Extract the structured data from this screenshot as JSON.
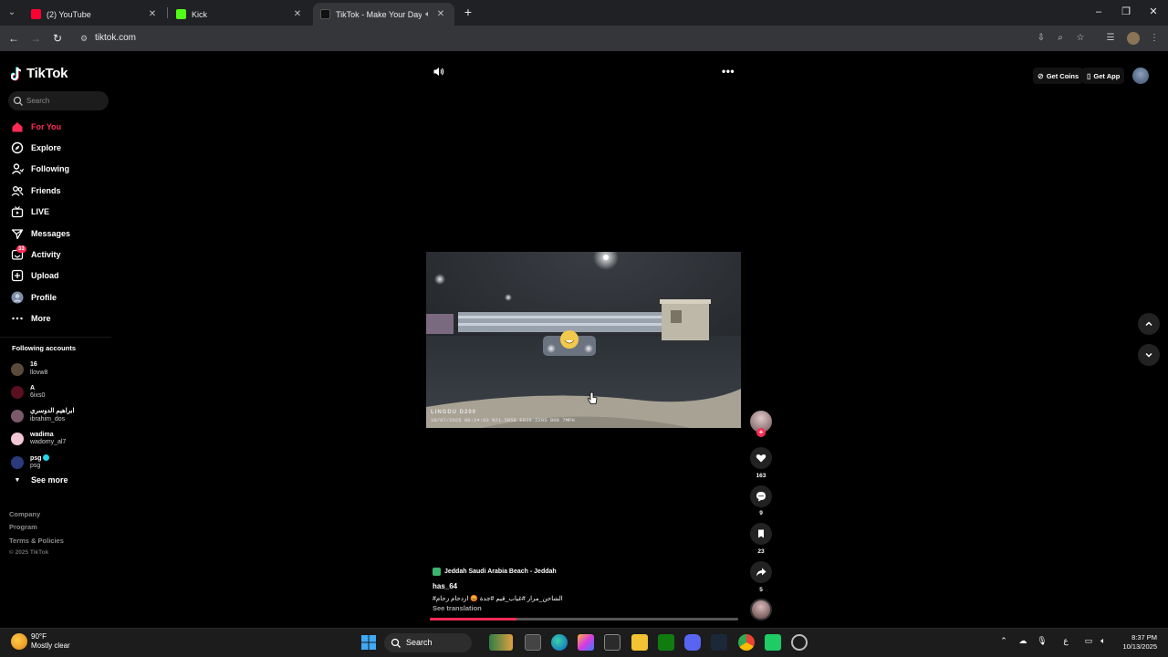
{
  "browser": {
    "tabs": [
      {
        "title": "(2) YouTube",
        "favicon_color": "#ff0033"
      },
      {
        "title": "Kick",
        "favicon_color": "#53fc18"
      },
      {
        "title": "TikTok - Make Your Day",
        "favicon_color": "#111111",
        "audio_icon": "speaker-icon"
      }
    ],
    "active_tab_index": 2,
    "url": "tiktok.com"
  },
  "tiktok": {
    "logo_text": "TikTok",
    "search_placeholder": "Search",
    "nav": [
      {
        "label": "For You",
        "icon": "home-icon",
        "active": true
      },
      {
        "label": "Explore",
        "icon": "compass-icon"
      },
      {
        "label": "Following",
        "icon": "following-icon"
      },
      {
        "label": "Friends",
        "icon": "friends-icon"
      },
      {
        "label": "LIVE",
        "icon": "live-icon"
      },
      {
        "label": "Messages",
        "icon": "messages-icon"
      },
      {
        "label": "Activity",
        "icon": "activity-icon",
        "badge": "33"
      },
      {
        "label": "Upload",
        "icon": "upload-icon"
      },
      {
        "label": "Profile",
        "icon": "profile-avatar"
      },
      {
        "label": "More",
        "icon": "more-icon"
      }
    ],
    "following_title": "Following accounts",
    "following": [
      {
        "name": "16",
        "handle": "llovw8",
        "color": "#5a4a3a"
      },
      {
        "name": "A",
        "handle": "6ixs0",
        "color": "#5a1020"
      },
      {
        "name": "ابراهيم الدوسري",
        "handle": "ibrahim_dos",
        "color": "#7a5a6a"
      },
      {
        "name": "wadima",
        "handle": "wadomy_al7",
        "color": "#f2c6d6"
      },
      {
        "name": "psg",
        "handle": "psg",
        "color": "#2a3a7a",
        "verified": true
      }
    ],
    "see_more": "See more",
    "footer": [
      "Company",
      "Program",
      "Terms & Policies"
    ],
    "copyright": "© 2025 TikTok",
    "get_coins": "Get Coins",
    "get_app": "Get App",
    "video": {
      "hud_brand": "LINGDU D200",
      "hud_line": "10/07/2025  00:24:03  N21.5058  E039.2205  008  7MPH",
      "location": "Jeddah Saudi Arabia Beach - Jeddah",
      "author": "has_64",
      "description": "#الشاحن_مرار  #غياب_قيم  #جدة 😡 ازدحام زحام",
      "see_translation": "See translation",
      "progress": 0.28
    },
    "actions": {
      "likes": "163",
      "comments": "9",
      "saves": "23",
      "shares": "5"
    }
  },
  "taskbar": {
    "weather_temp": "90°F",
    "weather_desc": "Mostly clear",
    "search_label": "Search",
    "lang": "ع",
    "time": "8:37 PM",
    "date": "10/13/2025"
  }
}
